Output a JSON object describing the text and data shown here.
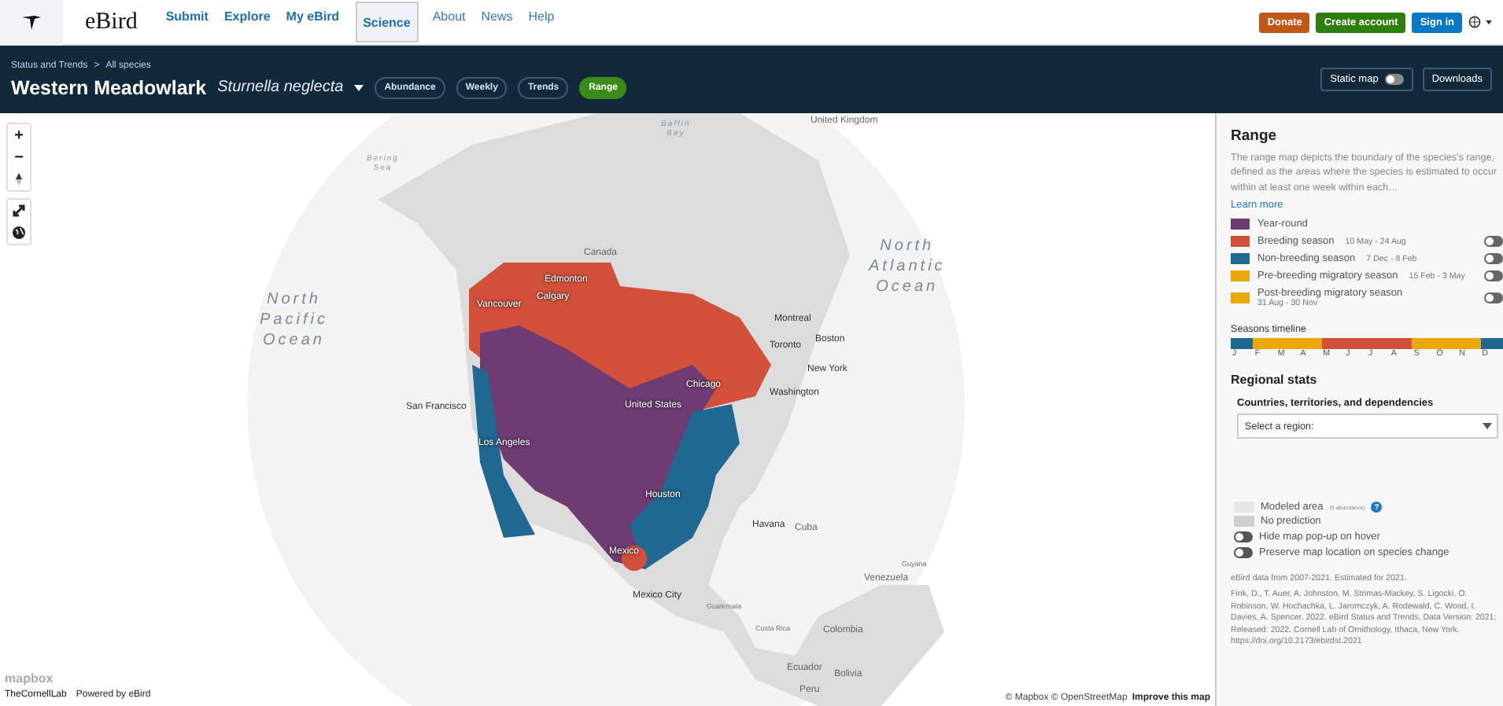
{
  "header": {
    "brand": "eBird",
    "nav": [
      {
        "label": "Submit",
        "selected": false,
        "kind": "primary"
      },
      {
        "label": "Explore",
        "selected": false,
        "kind": "primary"
      },
      {
        "label": "My eBird",
        "selected": false,
        "kind": "primary"
      },
      {
        "label": "Science",
        "selected": true,
        "kind": "primary"
      },
      {
        "label": "About",
        "selected": false,
        "kind": "secondary"
      },
      {
        "label": "News",
        "selected": false,
        "kind": "secondary"
      },
      {
        "label": "Help",
        "selected": false,
        "kind": "secondary"
      }
    ],
    "actions": [
      {
        "label": "Donate",
        "kind": "donate"
      },
      {
        "label": "Create account",
        "kind": "create"
      },
      {
        "label": "Sign in",
        "kind": "signin"
      }
    ]
  },
  "species_bar": {
    "breadcrumbs": [
      "Status and Trends",
      "All species"
    ],
    "separator": ">",
    "common_name": "Western Meadowlark",
    "scientific_name": "Sturnella neglecta",
    "tabs": [
      {
        "label": "Abundance",
        "selected": false
      },
      {
        "label": "Weekly",
        "selected": false
      },
      {
        "label": "Trends",
        "selected": false
      },
      {
        "label": "Range",
        "selected": true
      }
    ],
    "static_map": {
      "label": "Static map",
      "on": false
    },
    "downloads": "Downloads"
  },
  "map": {
    "labels": [
      {
        "text": "United Kingdom",
        "kind": "country"
      },
      {
        "text": "Baffin Bay",
        "kind": "sea"
      },
      {
        "text": "Bering Sea",
        "kind": "sea"
      },
      {
        "text": "Canada",
        "kind": "country"
      },
      {
        "text": "Edmonton",
        "kind": "on_range"
      },
      {
        "text": "North Atlantic Ocean",
        "kind": "ocean"
      },
      {
        "text": "North Pacific Ocean",
        "kind": "ocean"
      },
      {
        "text": "Vancouver",
        "kind": "on_range"
      },
      {
        "text": "Calgary",
        "kind": "on_range"
      },
      {
        "text": "Montreal",
        "kind": "city"
      },
      {
        "text": "Toronto",
        "kind": "city"
      },
      {
        "text": "Boston",
        "kind": "city"
      },
      {
        "text": "New York",
        "kind": "city"
      },
      {
        "text": "Chicago",
        "kind": "on_range"
      },
      {
        "text": "Washington",
        "kind": "city"
      },
      {
        "text": "San Francisco",
        "kind": "city"
      },
      {
        "text": "United States",
        "kind": "on_range"
      },
      {
        "text": "Los Angeles",
        "kind": "on_range"
      },
      {
        "text": "Houston",
        "kind": "on_range"
      },
      {
        "text": "Havana",
        "kind": "city"
      },
      {
        "text": "Cuba",
        "kind": "country"
      },
      {
        "text": "Mexico",
        "kind": "on_range"
      },
      {
        "text": "Guyana",
        "kind": "small"
      },
      {
        "text": "Venezuela",
        "kind": "country"
      },
      {
        "text": "Mexico City",
        "kind": "city"
      },
      {
        "text": "Guatemala",
        "kind": "small"
      },
      {
        "text": "Costa Rica",
        "kind": "small"
      },
      {
        "text": "Colombia",
        "kind": "country"
      },
      {
        "text": "Ecuador",
        "kind": "country"
      },
      {
        "text": "Bolivia",
        "kind": "country"
      },
      {
        "text": "Peru",
        "kind": "country"
      }
    ],
    "zoom_in": "+",
    "zoom_out": "−",
    "mapbox": "mapbox",
    "cornell": "TheCornellLab",
    "powered_by": "Powered by eBird",
    "attribution": "© Mapbox © OpenStreetMap",
    "improve": "Improve this map"
  },
  "panel": {
    "title": "Range",
    "description": "The range map depicts the boundary of the species's range, defined as the areas where the species is estimated to occur within at least one week within each…",
    "learn_more": "Learn more",
    "legend": [
      {
        "label": "Year-round",
        "color": "#6e3b73",
        "kind": "plain"
      },
      {
        "label": "Breeding season",
        "dates": "10 May - 24 Aug",
        "color": "#d2503a",
        "kind": "toggle",
        "on": false
      },
      {
        "label": "Non-breeding season",
        "dates": "7 Dec - 8 Feb",
        "color": "#1e6891",
        "kind": "toggle",
        "on": false
      },
      {
        "label": "Pre-breeding migratory season",
        "dates": "15 Feb - 3 May",
        "color": "#eaa90a",
        "kind": "toggle",
        "on": false
      },
      {
        "label": "Post-breeding migratory season",
        "dates": "31 Aug - 30 Nov",
        "color": "#eaa90a",
        "kind": "toggle_wrap",
        "on": false
      }
    ],
    "timeline_title": "Seasons timeline",
    "months": [
      {
        "letter": "J",
        "color": "#1e6891"
      },
      {
        "letter": "F",
        "color": "#eaa90a"
      },
      {
        "letter": "M",
        "color": "#eaa90a"
      },
      {
        "letter": "A",
        "color": "#eaa90a"
      },
      {
        "letter": "M",
        "color": "#d2503a"
      },
      {
        "letter": "J",
        "color": "#d2503a"
      },
      {
        "letter": "J",
        "color": "#d2503a"
      },
      {
        "letter": "A",
        "color": "#d2503a"
      },
      {
        "letter": "S",
        "color": "#eaa90a"
      },
      {
        "letter": "O",
        "color": "#eaa90a"
      },
      {
        "letter": "N",
        "color": "#eaa90a"
      },
      {
        "letter": "D",
        "color": "#1e6891"
      }
    ],
    "regional_title": "Regional stats",
    "regional_subtitle": "Countries, territories, and dependencies",
    "region_select": "Select a region:",
    "area_legend": [
      {
        "label": "Modeled area",
        "note": "(0 abundance)",
        "help": "?"
      },
      {
        "label": "No prediction"
      }
    ],
    "options": [
      {
        "label": "Hide map pop-up on hover",
        "on": false
      },
      {
        "label": "Preserve map location on species change",
        "on": false
      }
    ],
    "data_note": "eBird data from 2007-2021. Estimated for 2021.",
    "citation": "Fink, D., T. Auer, A. Johnston, M. Strimas-Mackey, S. Ligocki, O. Robinson, W. Hochachka, L. Jaromczyk, A. Rodewald, C. Wood, I. Davies, A. Spencer. 2022. eBird Status and Trends, Data Version: 2021; Released: 2022. Cornell Lab of Ornithology, Ithaca, New York. https://doi.org/10.2173/ebirdst.2021"
  }
}
